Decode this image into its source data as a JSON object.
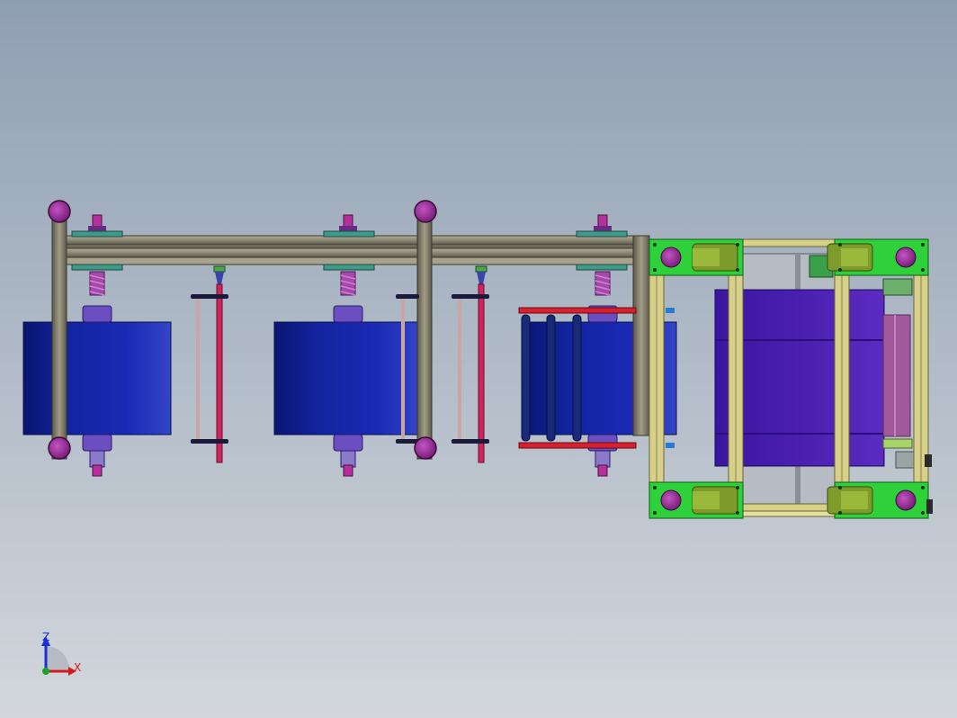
{
  "viewport": {
    "background_top": "#8f9fb2",
    "background_bottom": "#d3d7dd"
  },
  "colors": {
    "roll_blue": "#1324a0",
    "roll_blue_dark": "#0a1570",
    "roll_blue_light": "#2b3fc0",
    "frame_gray": "#8c8876",
    "frame_gray_dark": "#4a473c",
    "frame_gray_light": "#b3ae98",
    "bolt_purple": "#a335a3",
    "plate_teal": "#3f9a8a",
    "spring_violet": "#a04ca8",
    "shaft_crimson": "#d0245c",
    "bar_red": "#d8202e",
    "bracket_green": "#2fd13a",
    "bracket_olive": "#7d9b2a",
    "tube_yellow": "#d7d08a",
    "block_violet": "#4a1fb0",
    "hub_violet": "#6b4fc0"
  },
  "icons": {
    "mounting_bolt": "purple-circle-bolt",
    "axis_triad": "triad-icon"
  },
  "triad": {
    "z_label": "Z",
    "x_label": "X",
    "z_color": "#1b2fd6",
    "x_color": "#d11a1a",
    "y_color": "#18a52a"
  }
}
